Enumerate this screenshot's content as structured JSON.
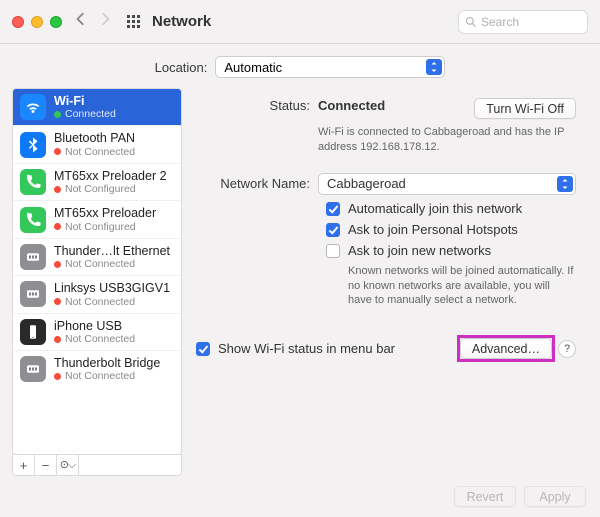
{
  "titlebar": {
    "title": "Network",
    "search_placeholder": "Search"
  },
  "location": {
    "label": "Location:",
    "value": "Automatic"
  },
  "sidebar": {
    "items": [
      {
        "name": "Wi-Fi",
        "status": "Connected",
        "statusColor": "green",
        "selected": true,
        "iconColor": "blue",
        "icon": "wifi"
      },
      {
        "name": "Bluetooth PAN",
        "status": "Not Connected",
        "statusColor": "red",
        "iconColor": "blue2",
        "icon": "bluetooth"
      },
      {
        "name": "MT65xx Preloader 2",
        "status": "Not Configured",
        "statusColor": "red",
        "iconColor": "green",
        "icon": "phone"
      },
      {
        "name": "MT65xx Preloader",
        "status": "Not Configured",
        "statusColor": "red",
        "iconColor": "green",
        "icon": "phone"
      },
      {
        "name": "Thunder…lt Ethernet",
        "status": "Not Connected",
        "statusColor": "red",
        "iconColor": "gray",
        "icon": "ethernet"
      },
      {
        "name": "Linksys USB3GIGV1",
        "status": "Not Connected",
        "statusColor": "red",
        "iconColor": "gray",
        "icon": "ethernet"
      },
      {
        "name": "iPhone USB",
        "status": "Not Connected",
        "statusColor": "red",
        "iconColor": "dark",
        "icon": "iphone"
      },
      {
        "name": "Thunderbolt Bridge",
        "status": "Not Connected",
        "statusColor": "red",
        "iconColor": "gray",
        "icon": "ethernet"
      }
    ],
    "footer": {
      "add": "+",
      "remove": "−",
      "more": "⊙⌵"
    }
  },
  "detail": {
    "status_label": "Status:",
    "status_value": "Connected",
    "turn_off": "Turn Wi-Fi Off",
    "status_sub": "Wi-Fi is connected to Cabbageroad and has the IP address 192.168.178.12.",
    "netname_label": "Network Name:",
    "netname_value": "Cabbageroad",
    "auto_join": "Automatically join this network",
    "ask_hotspots": "Ask to join Personal Hotspots",
    "ask_new": "Ask to join new networks",
    "ask_new_hint": "Known networks will be joined automatically. If no known networks are available, you will have to manually select a network.",
    "menubar": "Show Wi-Fi status in menu bar",
    "advanced": "Advanced…",
    "qmark": "?"
  },
  "footer": {
    "revert": "Revert",
    "apply": "Apply"
  }
}
